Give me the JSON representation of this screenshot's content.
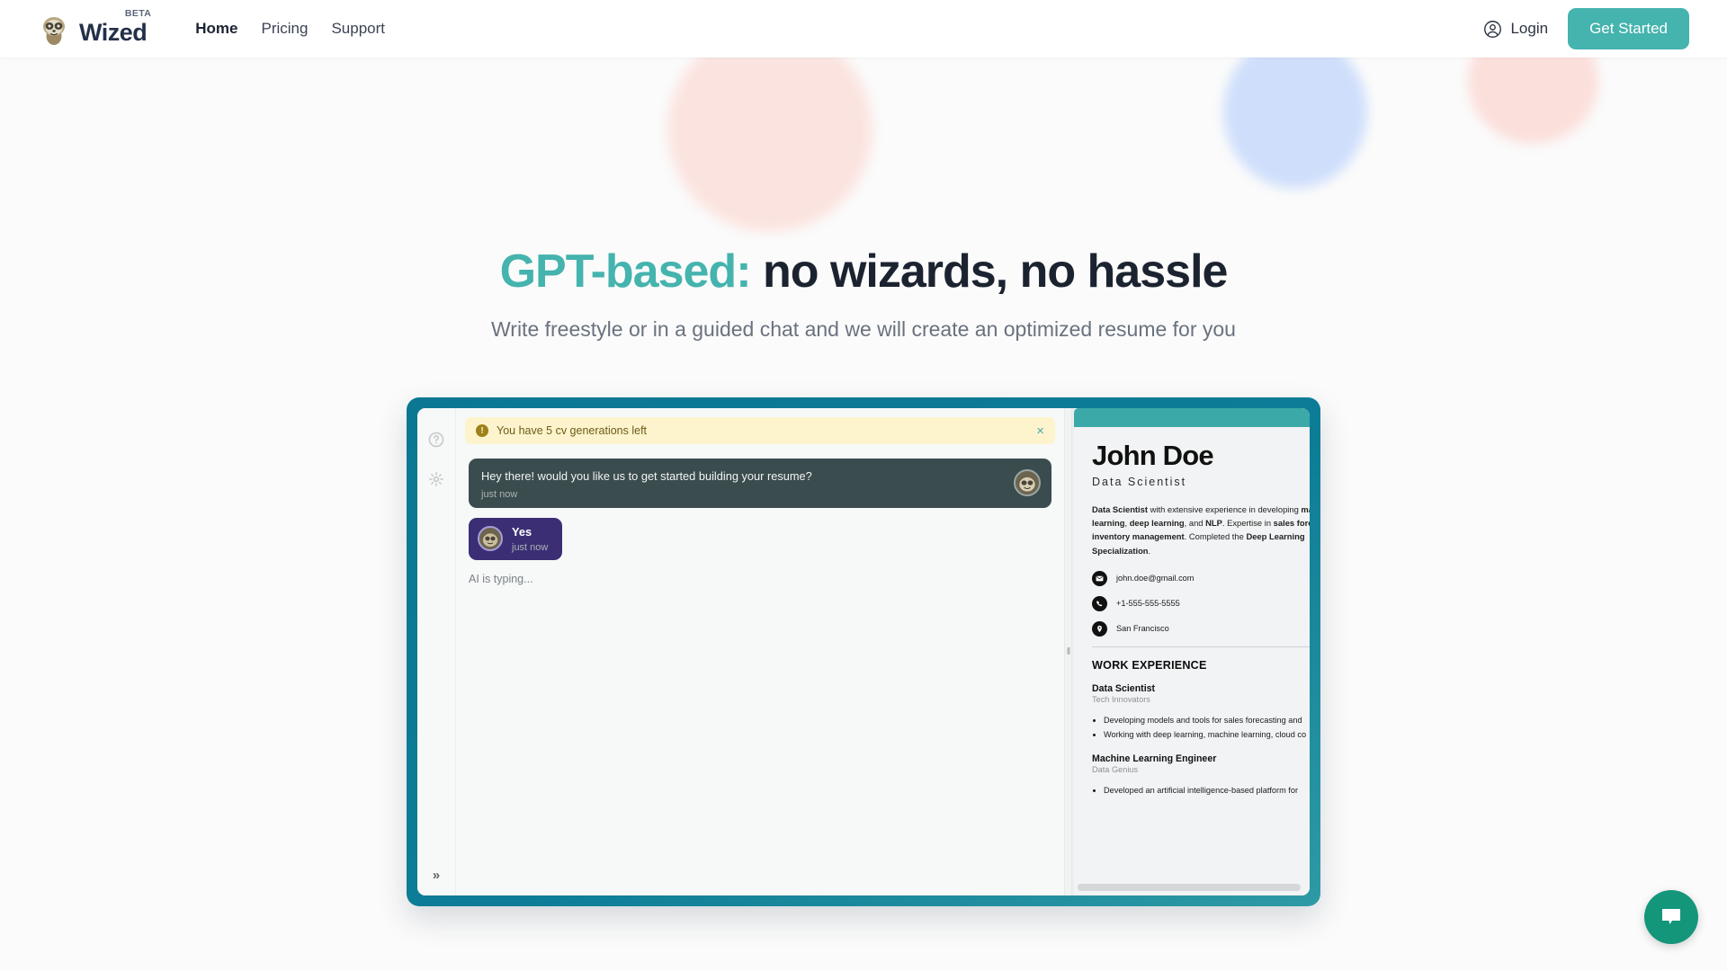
{
  "header": {
    "brand_name": "Wized",
    "brand_badge": "BETA",
    "logo_icon": "sloth-logo-icon",
    "nav": [
      {
        "label": "Home",
        "active": true
      },
      {
        "label": "Pricing",
        "active": false
      },
      {
        "label": "Support",
        "active": false
      }
    ],
    "login_label": "Login",
    "login_icon": "user-circle-icon",
    "get_started_label": "Get Started"
  },
  "hero": {
    "headline_accent": "GPT-based:",
    "headline_rest": " no wizards, no hassle",
    "subhead": "Write freestyle or in a guided chat and we will create an optimized resume for you"
  },
  "app": {
    "sidebar": {
      "help_icon": "question-circle-icon",
      "settings_icon": "gear-icon",
      "expand_label": "»"
    },
    "alert": {
      "icon": "info-icon",
      "icon_glyph": "!",
      "text": "You have 5 cv generations left",
      "close_label": "×"
    },
    "chat": {
      "messages": [
        {
          "role": "assistant",
          "text": "Hey there! would you like us to get started building your resume?",
          "time": "just now",
          "avatar": "sloth-avatar-icon"
        },
        {
          "role": "user",
          "text": "Yes",
          "time": "just now",
          "avatar": "sloth-avatar-icon"
        }
      ],
      "typing_status": "AI is typing..."
    },
    "divider_grip": "‖",
    "resume": {
      "name": "John Doe",
      "role": "Data Scientist",
      "summary_html": "<b>Data Scientist</b> with extensive experience in developing <b>machine learning</b>, <b>deep learning</b>, and <b>NLP</b>. Expertise in <b>sales forecasting</b> and <b>inventory management</b>. Completed the <b>Deep Learning Specialization</b>.",
      "contacts": [
        {
          "icon": "envelope-icon",
          "text": "john.doe@gmail.com"
        },
        {
          "icon": "phone-icon",
          "text": "+1-555-555-5555"
        },
        {
          "icon": "location-pin-icon",
          "text": "San Francisco"
        }
      ],
      "section_title": "WORK EXPERIENCE",
      "jobs": [
        {
          "title": "Data Scientist",
          "company": "Tech Innovators",
          "bullets": [
            "Developing models and tools for sales forecasting and",
            "Working with deep learning, machine learning, cloud co"
          ]
        },
        {
          "title": "Machine Learning Engineer",
          "company": "Data Genius",
          "bullets": [
            "Developed an artificial intelligence-based platform for"
          ]
        }
      ]
    }
  },
  "chat_widget": {
    "icon": "chat-bubble-icon",
    "color": "#14967b"
  },
  "colors": {
    "accent_teal": "#45b3ae",
    "frame_teal": "#0d7d97",
    "headline_dark": "#1c2330",
    "alert_bg": "#fdf4cd",
    "user_bubble": "#3b2e74",
    "ai_bubble": "#3b4c4f"
  }
}
